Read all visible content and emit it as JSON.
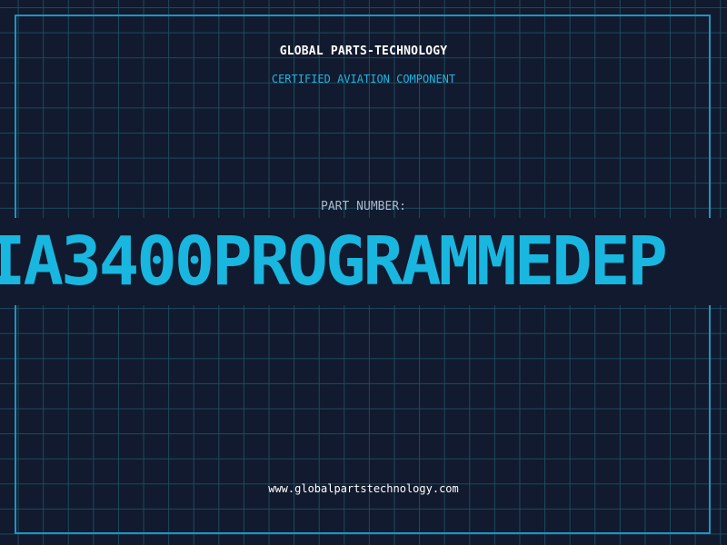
{
  "header": {
    "company_name": "GLOBAL PARTS-TECHNOLOGY",
    "tagline": "CERTIFIED AVIATION COMPONENT"
  },
  "part": {
    "label": "PART NUMBER:",
    "number": "IA3400PROGRAMMEDEP"
  },
  "footer": {
    "website": "www.globalpartstechnology.com"
  },
  "colors": {
    "background": "#111a2e",
    "grid_line": "#1d4a5e",
    "frame": "#1f95bf",
    "accent": "#19b6e0",
    "label": "#a9b8c8",
    "text": "#ffffff"
  }
}
